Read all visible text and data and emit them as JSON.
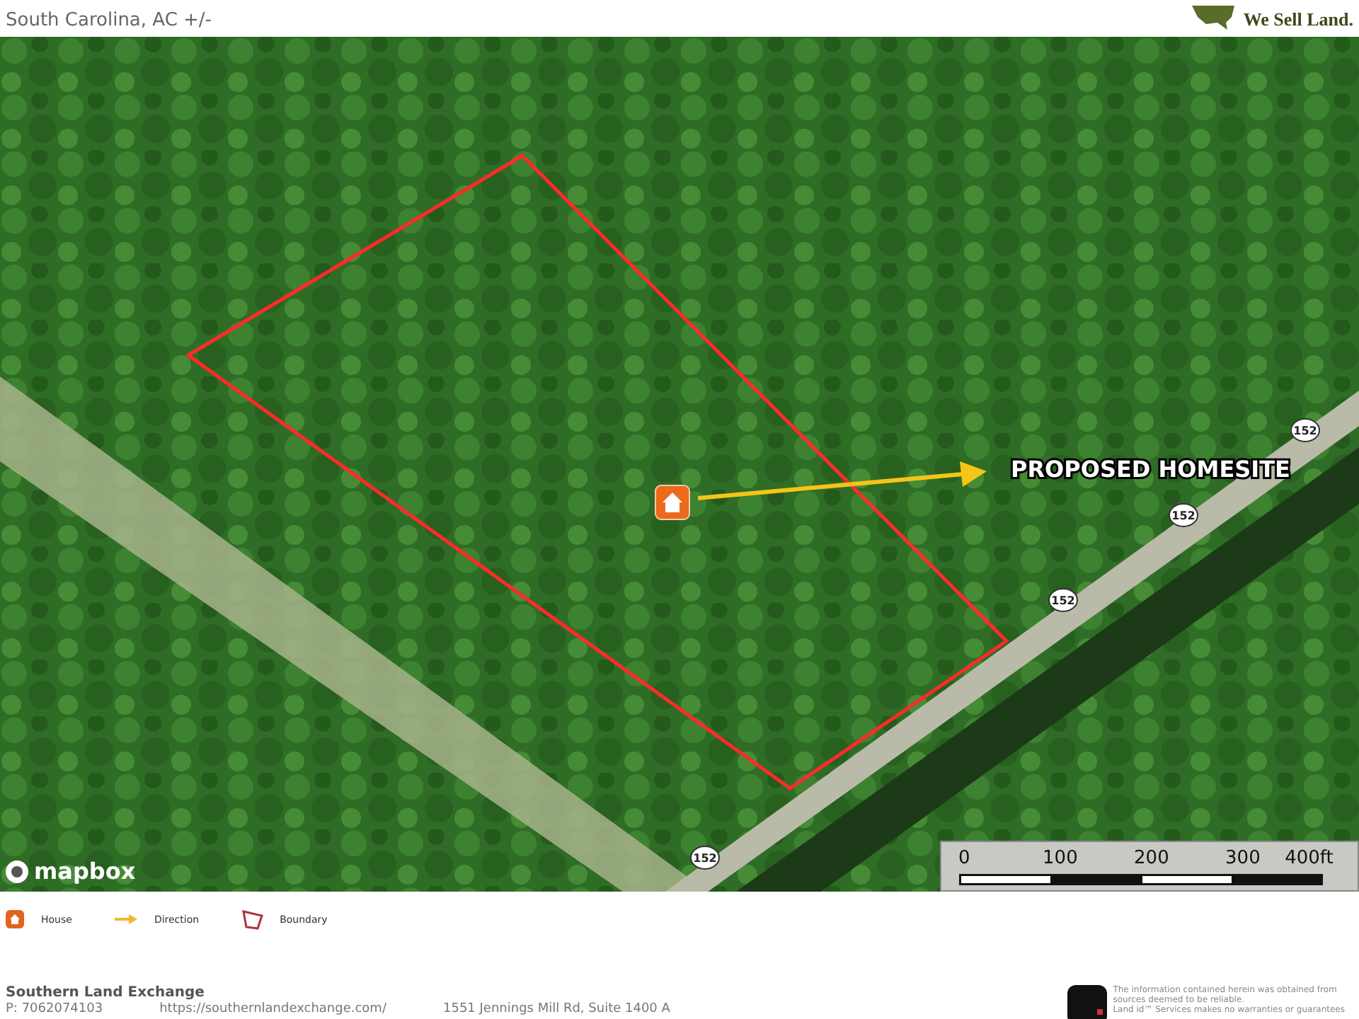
{
  "header": {
    "subtitle": "South Carolina,  AC +/-",
    "tagline": "We Sell Land."
  },
  "map": {
    "callout": "PROPOSED HOMESITE",
    "attribution": "mapbox",
    "route_shields": [
      "152",
      "152",
      "152",
      "152"
    ],
    "scale_bar": [
      "0",
      "100",
      "200",
      "300",
      "400ft"
    ]
  },
  "legend": [
    {
      "kind": "house",
      "label": "House"
    },
    {
      "kind": "direction",
      "label": "Direction"
    },
    {
      "kind": "boundary",
      "label": "Boundary"
    }
  ],
  "footer": {
    "company": "Southern Land Exchange",
    "contacts": [
      "P: 7062074103",
      "https://southernlandexchange.com/",
      "1551 Jennings Mill Rd, Suite 1400 A"
    ],
    "disclaimer": [
      "The information contained herein was obtained from",
      "sources deemed to be reliable.",
      "Land id™ Services makes no warranties or guarantees"
    ]
  }
}
